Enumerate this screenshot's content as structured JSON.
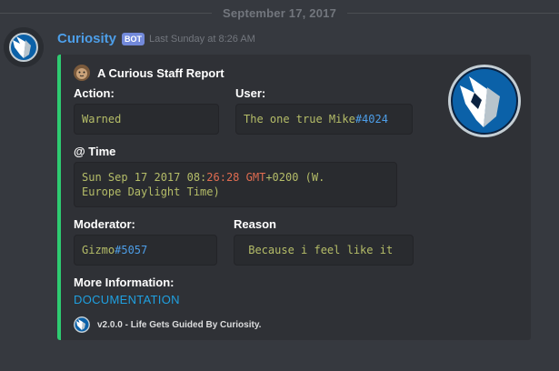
{
  "divider": {
    "date": "September 17, 2017"
  },
  "message": {
    "username": "Curiosity",
    "bot_tag": "BOT",
    "timestamp": "Last Sunday at 8:26 AM"
  },
  "embed": {
    "accent_color": "#2ecc71",
    "author": "A Curious Staff Report",
    "fields": {
      "action": {
        "name": "Action:",
        "value": "Warned"
      },
      "user": {
        "name": "User:",
        "value_text": "The one true Mike",
        "value_tag": "#4024"
      },
      "time": {
        "name": "@ Time",
        "parts": {
          "a": "Sun Sep 17 2017 08:",
          "b": "26:28",
          "c": " GMT",
          "d": "+0200",
          "e": " (W.\nEurope Daylight Time)"
        }
      },
      "moderator": {
        "name": "Moderator:",
        "value_text": "Gizmo",
        "value_tag": "#5057"
      },
      "reason": {
        "name": "Reason",
        "value": " Because i feel like it"
      },
      "more_info": {
        "name": "More Information:",
        "link": "DOCUMENTATION"
      }
    },
    "footer": "v2.0.0 - Life Gets Guided By Curiosity.",
    "icons": {
      "avatar": "dallas-mavericks-logo-icon",
      "thumbnail": "dallas-mavericks-logo-icon",
      "author": "tiger-icon",
      "footer": "dallas-mavericks-logo-icon"
    }
  }
}
